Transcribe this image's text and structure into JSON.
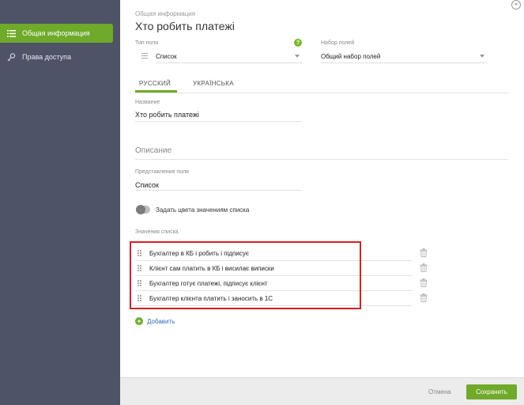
{
  "sidebar": {
    "items": [
      {
        "label": "Общая информация",
        "icon": "list-icon",
        "active": true
      },
      {
        "label": "Права доступа",
        "icon": "key-icon",
        "active": false
      }
    ]
  },
  "header": {
    "subtitle": "Общая информация",
    "title": "Хто робить платежі"
  },
  "field_type": {
    "label": "Тип поля",
    "value": "Список"
  },
  "field_set": {
    "label": "Набор полей",
    "value": "Общий набор полей"
  },
  "tabs": [
    {
      "label": "РУССКИЙ",
      "active": true
    },
    {
      "label": "УКРАЇНСЬКА",
      "active": false
    }
  ],
  "name_field": {
    "label": "Название",
    "value": "Хто робить платежі"
  },
  "description_section": {
    "title": "Описание"
  },
  "presentation_field": {
    "label": "Представление поля",
    "value": "Список"
  },
  "color_toggle": {
    "label": "Задать цвета значениям списка",
    "enabled": false
  },
  "list_values": {
    "label": "Значения списка",
    "items": [
      "Бухгалтер в КБ  і робить і підписує",
      "Клієнт сам платить в КБ і висилає виписки",
      "Бухгалтер готує платежі, підписує клієнт",
      "Бухгалтер клієнта платить і заносить в 1С"
    ],
    "add_label": "Добавить"
  },
  "footer": {
    "cancel_label": "Отмена",
    "save_label": "Сохранить"
  },
  "colors": {
    "accent": "#6faa2a",
    "sidebar_bg": "#4e5367",
    "highlight": "#d42020",
    "link": "#2f6fb5"
  }
}
